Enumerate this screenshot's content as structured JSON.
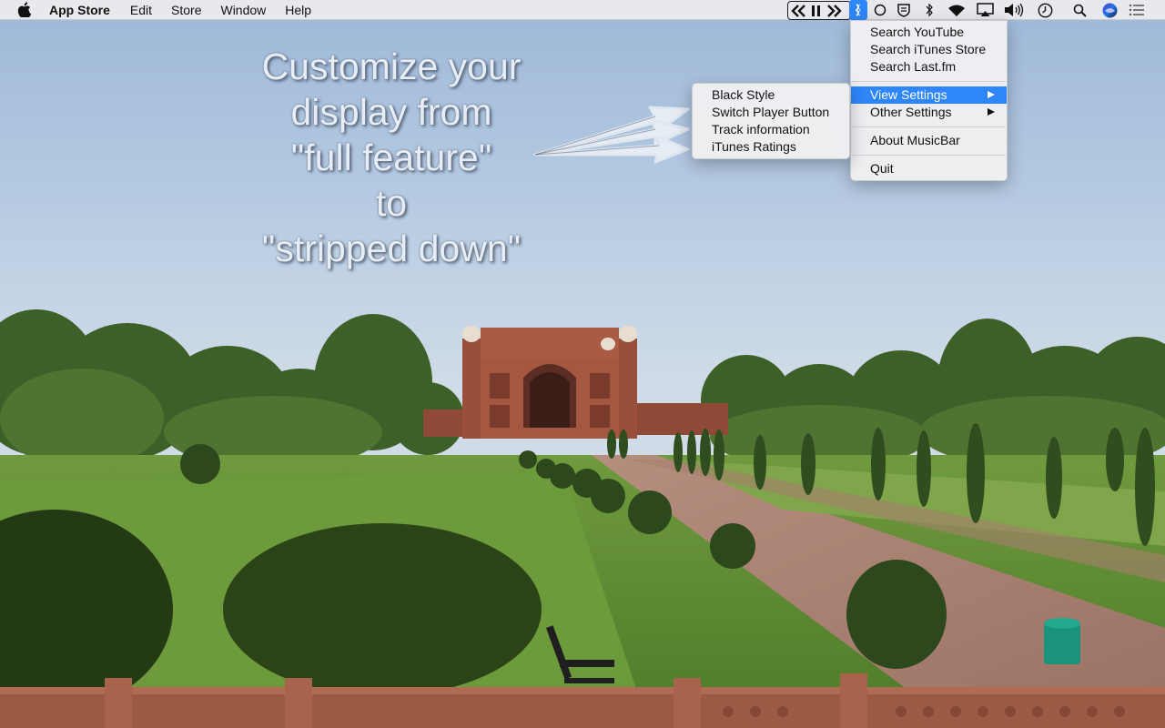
{
  "menubar": {
    "app_name": "App Store",
    "items": [
      "Edit",
      "Store",
      "Window",
      "Help"
    ]
  },
  "status_icons": [
    "previous-icon",
    "pause-icon",
    "next-icon",
    "musicbar-icon",
    "circle-icon",
    "shield-icon",
    "bluetooth-icon",
    "wifi-icon",
    "airplay-icon",
    "volume-icon",
    "clock-icon",
    "spotlight-icon",
    "siri-icon",
    "notification-center-icon"
  ],
  "musicbar_menu": {
    "search_youtube": "Search YouTube",
    "search_itunes": "Search iTunes Store",
    "search_lastfm": "Search Last.fm",
    "view_settings": "View Settings",
    "other_settings": "Other Settings",
    "about": "About MusicBar",
    "quit": "Quit"
  },
  "view_settings_submenu": {
    "black_style": "Black Style",
    "switch_player_button": "Switch Player Button",
    "track_information": "Track information",
    "itunes_ratings": "iTunes Ratings"
  },
  "callout": {
    "line1": "Customize your",
    "line2": "display from",
    "line3": "\"full feature\"",
    "line4": "to",
    "line5": "\"stripped down\""
  },
  "colors": {
    "accent": "#2f86f8",
    "menubar": "#ececee",
    "menu_bg": "#f0f0f2"
  }
}
